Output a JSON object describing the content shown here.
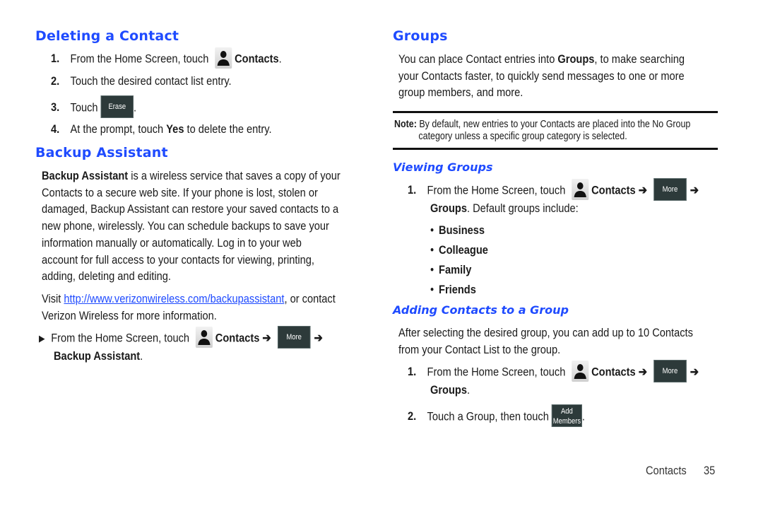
{
  "left": {
    "deleting": {
      "heading": "Deleting a Contact",
      "steps": [
        {
          "num": "1.",
          "pre": "From the Home Screen, touch",
          "icon": "contacts-icon",
          "bold": "Contacts",
          "post": "."
        },
        {
          "num": "2.",
          "text": "Touch the desired contact list entry."
        },
        {
          "num": "3.",
          "pre": "Touch",
          "button": "Erase",
          "post": "."
        },
        {
          "num": "4.",
          "pre": "At the prompt, touch ",
          "bold": "Yes",
          "post": " to delete the entry."
        }
      ]
    },
    "backup": {
      "heading": "Backup Assistant",
      "para_bold": "Backup Assistant",
      "para_lines": [
        " is a wireless service that saves a copy of your",
        "Contacts to a secure web site. If your phone is lost, stolen or",
        "damaged, Backup Assistant can restore your saved contacts to a",
        "new phone, wirelessly. You can schedule backups to save your",
        "information manually or automatically. Log in to your web",
        "account for full access to your contacts for viewing, printing,",
        "adding, deleting and editing."
      ],
      "visit_pre": "Visit ",
      "visit_link": "http://www.verizonwireless.com/backupassistant",
      "visit_post": ", or contact",
      "visit_line2": "Verizon Wireless for more information.",
      "step_marker": "▶",
      "step_pre": "From the Home Screen, touch",
      "step_contacts": "Contacts ➔",
      "step_button": "More",
      "step_arrow": "➔",
      "step_final": "Backup Assistant",
      "step_final_post": "."
    }
  },
  "right": {
    "groups": {
      "heading": "Groups",
      "para_pre": "You can place Contact entries into ",
      "para_bold": "Groups",
      "para_post": ", to make searching",
      "para_line2": "your Contacts faster, to quickly send messages to one or more",
      "para_line3": "group members, and more.",
      "note_label": "Note:",
      "note_line1": " By default, new entries to your Contacts are placed into the No Group",
      "note_line2": "category unless a specific group category is selected."
    },
    "viewing": {
      "heading": "Viewing Groups",
      "step_num": "1.",
      "step_pre": "From the Home Screen, touch",
      "step_contacts": "Contacts ➔",
      "step_button": "More",
      "step_arrow": "➔",
      "step_line2_bold": "Groups",
      "step_line2": ". Default groups include:",
      "bullet": "•",
      "groups": [
        "Business",
        "Colleague",
        "Family",
        "Friends"
      ]
    },
    "adding": {
      "heading": "Adding Contacts to a Group",
      "para_line1": "After selecting the desired group, you can add up to 10 Contacts",
      "para_line2": "from your Contact List to the group.",
      "step1_num": "1.",
      "step1_pre": "From the Home Screen, touch",
      "step1_contacts": "Contacts ➔",
      "step1_button": "More",
      "step1_arrow": "➔",
      "step1_line2_bold": "Groups",
      "step1_line2_post": ".",
      "step2_num": "2.",
      "step2_pre": "Touch a Group, then touch",
      "step2_button_line1": "Add",
      "step2_button_line2": "Members",
      "step2_post": "."
    }
  },
  "footer": {
    "section": "Contacts",
    "page": "35"
  }
}
